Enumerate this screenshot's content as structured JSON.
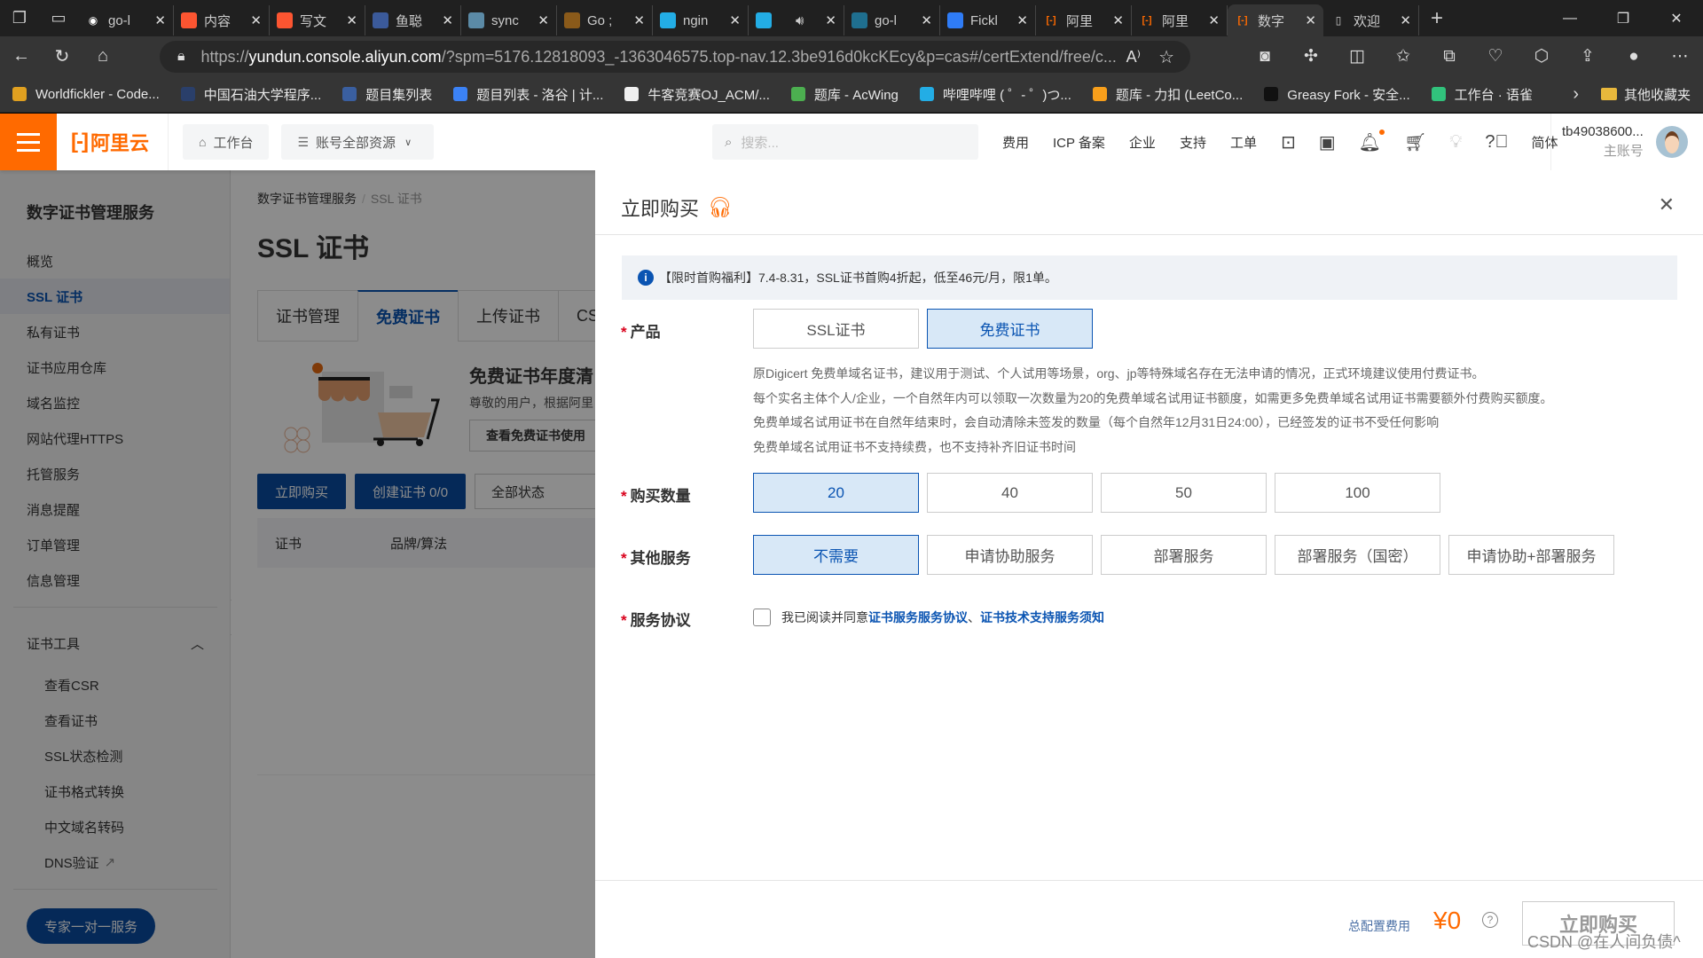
{
  "browser": {
    "tabs": [
      {
        "title": "go-l",
        "icon": "github-icon",
        "color": "#ffffff"
      },
      {
        "title": "内容",
        "icon": "csdn-icon",
        "color": "#fc5531"
      },
      {
        "title": "写文",
        "icon": "csdn-icon",
        "color": "#fc5531"
      },
      {
        "title": "鱼聪",
        "icon": "yucong-icon",
        "color": "#3b5a9a"
      },
      {
        "title": "sync",
        "icon": "gopher-icon",
        "color": "#5b8aa6"
      },
      {
        "title": "Go ;",
        "icon": "doc-icon",
        "color": "#8a5a1a"
      },
      {
        "title": "ngin",
        "icon": "bilibili-icon",
        "color": "#23ade5"
      },
      {
        "title": "",
        "icon": "bilibili-icon",
        "color": "#23ade5",
        "audio": "speaker-icon"
      },
      {
        "title": "go-l",
        "icon": "bilibili-icon",
        "color": "#1f6f8f"
      },
      {
        "title": "Fickl",
        "icon": "fickle-icon",
        "color": "#2f7cf6"
      },
      {
        "title": "阿里",
        "icon": "aliyun-icon",
        "color": "#ff6a00"
      },
      {
        "title": "阿里",
        "icon": "aliyun-icon",
        "color": "#ff6a00"
      },
      {
        "title": "数字",
        "icon": "aliyun-icon",
        "color": "#ff6a00",
        "active": true
      },
      {
        "title": "欢迎",
        "icon": "page-icon",
        "color": "#cccccc"
      }
    ],
    "url_prefix": "https://",
    "url_host": "yundun.console.aliyun.com",
    "url_rest": "/?spm=5176.12818093_-1363046575.top-nav.12.3be916d0kcKEcy&p=cas#/certExtend/free/c...",
    "bookmarks": [
      {
        "label": "Worldfickler - Code...",
        "color": "#e0a020"
      },
      {
        "label": "中国石油大学程序...",
        "color": "#2a3f6a"
      },
      {
        "label": "题目集列表",
        "color": "#3a5fa0"
      },
      {
        "label": "题目列表 - 洛谷 | 计...",
        "color": "#3b82f6"
      },
      {
        "label": "牛客竞赛OJ_ACM/...",
        "color": "#f0f0f0"
      },
      {
        "label": "题库 - AcWing",
        "color": "#4caf50"
      },
      {
        "label": "哔哩哔哩 ( ゜- ゜)つ...",
        "color": "#23ade5"
      },
      {
        "label": "题库 - 力扣 (LeetCo...",
        "color": "#f89f1b"
      },
      {
        "label": "Greasy Fork - 安全...",
        "color": "#111111"
      },
      {
        "label": "工作台 · 语雀",
        "color": "#31c27c"
      }
    ],
    "other_bookmarks": "其他收藏夹"
  },
  "topbar": {
    "logo": "阿里云",
    "workbench": "工作台",
    "resources": "账号全部资源",
    "search_placeholder": "搜索...",
    "nav": [
      "费用",
      "ICP 备案",
      "企业",
      "支持",
      "工单"
    ],
    "lang": "简体",
    "account_name": "tb49038600...",
    "account_role": "主账号"
  },
  "sidebar": {
    "title": "数字证书管理服务",
    "items": [
      "概览",
      "SSL 证书",
      "私有证书",
      "证书应用仓库",
      "域名监控",
      "网站代理HTTPS",
      "托管服务",
      "消息提醒",
      "订单管理",
      "信息管理"
    ],
    "active_index": 1,
    "group_label": "证书工具",
    "tools": [
      "查看CSR",
      "查看证书",
      "SSL状态检测",
      "证书格式转换",
      "中文域名转码",
      "DNS验证"
    ],
    "expert_button": "专家一对一服务"
  },
  "main": {
    "breadcrumb_root": "数字证书管理服务",
    "breadcrumb_current": "SSL 证书",
    "title": "SSL 证书",
    "tabs": [
      "证书管理",
      "免费证书",
      "上传证书",
      "CSR"
    ],
    "active_tab": 1,
    "promo_title": "免费证书年度清",
    "promo_sub": "尊敬的用户，根据阿里",
    "promo_button": "查看免费证书使用",
    "buy_button": "立即购买",
    "create_button": "创建证书 0/0",
    "status_select": "全部状态",
    "table_headers": [
      "证书",
      "品牌/算法"
    ]
  },
  "drawer": {
    "title": "立即购买",
    "notice": "【限时首购福利】7.4-8.31，SSL证书首购4折起，低至46元/月，限1单。",
    "product_label": "产品",
    "product_options": [
      "SSL证书",
      "免费证书"
    ],
    "product_selected": 1,
    "description": [
      "原Digicert 免费单域名证书，建议用于测试、个人试用等场景，org、jp等特殊域名存在无法申请的情况，正式环境建议使用付费证书。",
      "每个实名主体个人/企业，一个自然年内可以领取一次数量为20的免费单域名试用证书额度，如需更多免费单域名试用证书需要额外付费购买额度。",
      "免费单域名试用证书在自然年结束时，会自动清除未签发的数量（每个自然年12月31日24:00），已经签发的证书不受任何影响",
      "免费单域名试用证书不支持续费，也不支持补齐旧证书时间"
    ],
    "quantity_label": "购买数量",
    "quantity_options": [
      "20",
      "40",
      "50",
      "100"
    ],
    "quantity_selected": 0,
    "service_label": "其他服务",
    "service_options": [
      "不需要",
      "申请协助服务",
      "部署服务",
      "部署服务（国密）",
      "申请协助+部署服务"
    ],
    "service_selected": 0,
    "agreement_label": "服务协议",
    "agreement_prefix": "我已阅读并同意",
    "agreement_link1": "证书服务服务协议",
    "agreement_sep": "、",
    "agreement_link2": "证书技术支持服务须知",
    "agreement_checked": false,
    "total_label": "总配置费用",
    "total_value": "¥0",
    "buy_button": "立即购买"
  },
  "watermark": "CSDN @在人间负债^",
  "colors": {
    "brand": "#ff6a00",
    "primary": "#0a54b2",
    "selected_bg": "#d8e8f7"
  }
}
